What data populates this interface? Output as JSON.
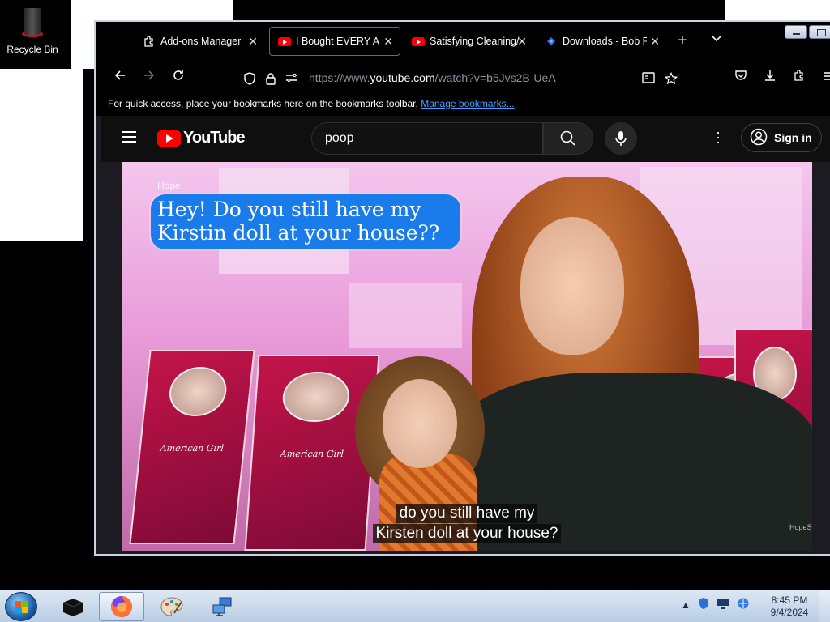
{
  "desktop": {
    "recycle_bin_label": "Recycle Bin"
  },
  "browser": {
    "tabs": [
      {
        "label": "Add-ons Manager",
        "icon": "puzzle-icon",
        "active": false
      },
      {
        "label": "I Bought EVERY Am",
        "icon": "youtube-icon",
        "active": true
      },
      {
        "label": "Satisfying Cleaning/",
        "icon": "youtube-icon",
        "active": false
      },
      {
        "label": "Downloads - Bob P",
        "icon": "download-icon",
        "active": false
      }
    ],
    "url_host": "https://www.",
    "url_domain": "youtube.com",
    "url_path": "/watch?v=b5Jvs2B-UeA",
    "bookmarks_text": "For quick access, place your bookmarks here on the bookmarks toolbar.",
    "bookmarks_link": "Manage bookmarks..."
  },
  "youtube": {
    "logo_text": "YouTube",
    "search_value": "poop",
    "sign_in_label": "Sign in"
  },
  "video": {
    "speaker_label": "Hope",
    "bubble_line1": "Hey! Do you still have my",
    "bubble_line2": "Kirstin doll at your house??",
    "caption_line1": "do you still have my",
    "caption_line2": "Kirsten doll at your house?",
    "box_brand": "American Girl",
    "watermark": "HopeScope"
  },
  "taskbar": {
    "time": "8:45 PM",
    "date": "9/4/2024"
  },
  "colors": {
    "youtube_red": "#ff0000",
    "link_blue": "#45a1ff",
    "bubble_blue": "#1a7bea"
  }
}
